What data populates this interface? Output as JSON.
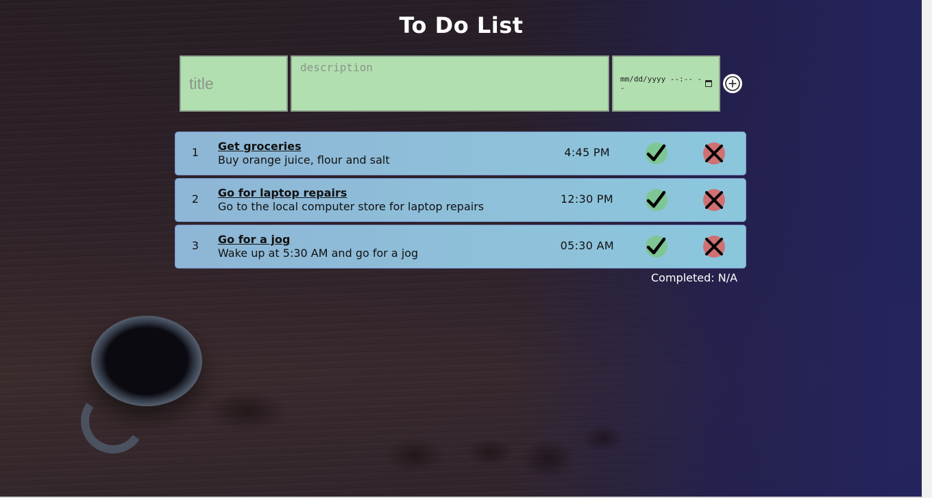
{
  "header": {
    "title": "To Do List"
  },
  "form": {
    "title_placeholder": "title",
    "description_placeholder": "description",
    "date_placeholder": "mm/dd/yyyy --:-- --"
  },
  "todos": [
    {
      "number": "1",
      "title": "Get groceries",
      "description": "Buy orange juice, flour and salt",
      "time": "4:45 PM"
    },
    {
      "number": "2",
      "title": "Go for laptop repairs",
      "description": "Go to the local computer store for laptop repairs",
      "time": "12:30 PM"
    },
    {
      "number": "3",
      "title": "Go for a jog",
      "description": "Wake up at 5:30 AM and go for a jog",
      "time": "05:30 AM"
    }
  ],
  "footer": {
    "completed_text": "Completed: N/A"
  },
  "icons": {
    "add": "plus-circle-icon",
    "complete": "checkmark-icon",
    "delete": "x-mark-icon",
    "date": "calendar-icon"
  },
  "colors": {
    "input_background": "#b2dfb0",
    "item_background": "#8ec1da",
    "complete_button": "#7ec694",
    "delete_button": "#cf7072",
    "title_text": "#ffffff"
  }
}
